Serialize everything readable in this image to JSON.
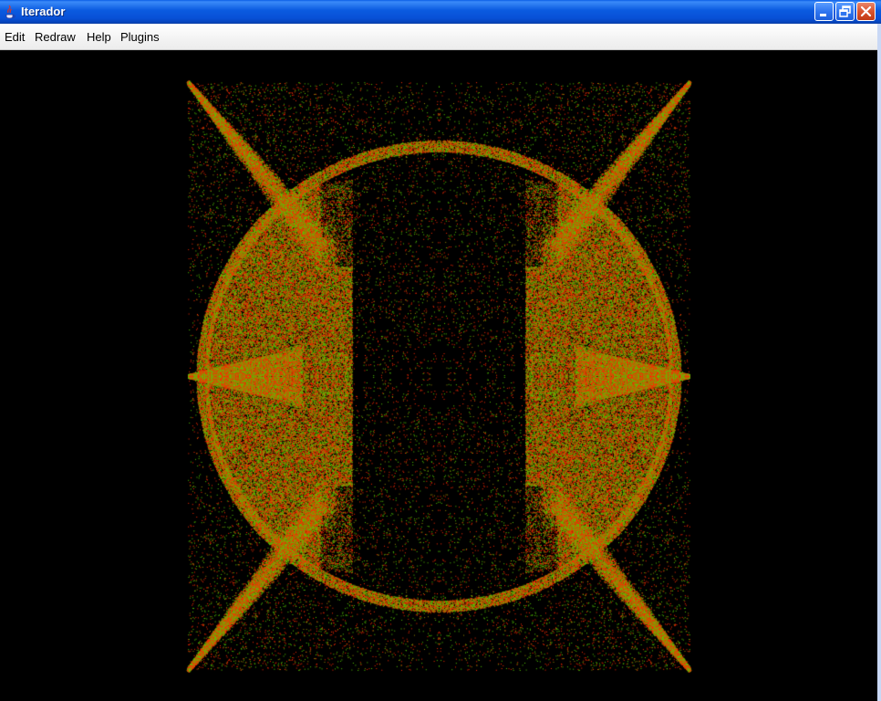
{
  "window": {
    "title": "Iterador",
    "icon": "java-cup-icon"
  },
  "caption_buttons": [
    "minimize",
    "restore",
    "close"
  ],
  "menu": {
    "items": [
      {
        "label": "Edit"
      },
      {
        "label": "Redraw"
      },
      {
        "label": "Help"
      },
      {
        "label": "Plugins"
      }
    ]
  },
  "canvas": {
    "content": "symmetric point-cloud fractal",
    "background": "#000000",
    "point_colors": [
      "#ff2a00",
      "#55cc00",
      "#9a8a00"
    ]
  }
}
